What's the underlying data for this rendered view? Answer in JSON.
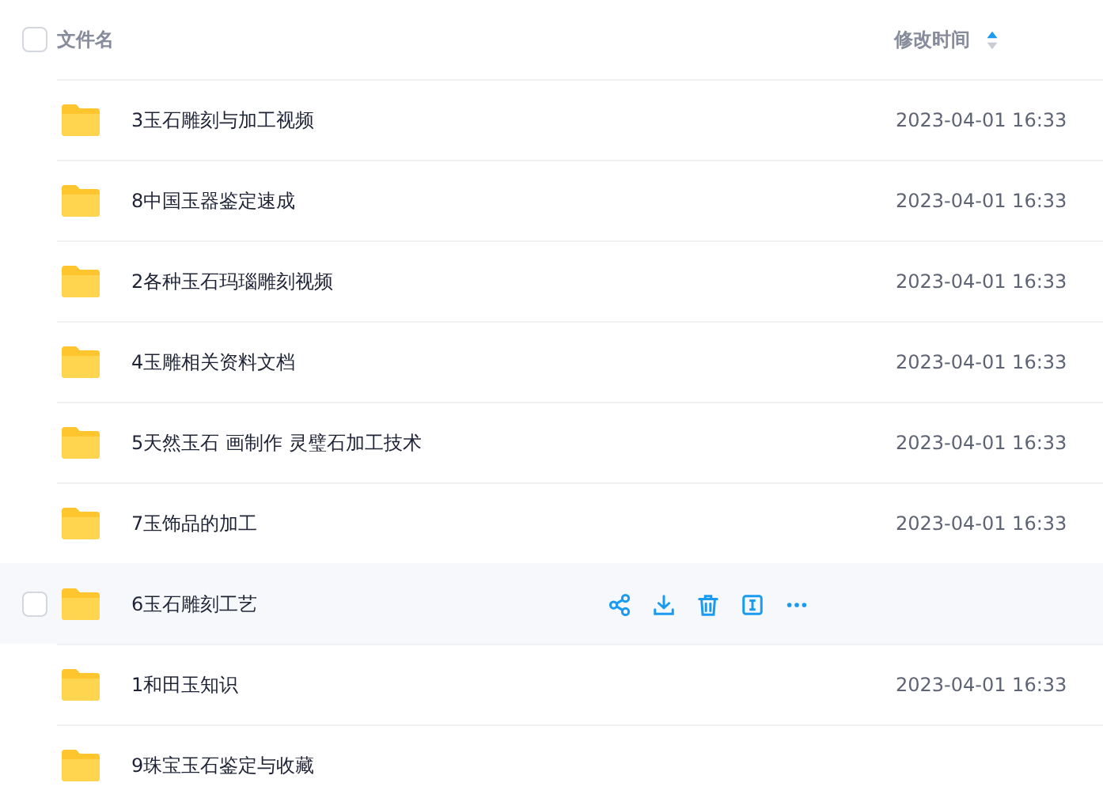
{
  "header": {
    "checked": false,
    "name_label": "文件名",
    "time_label": "修改时间",
    "sort_ascending": true
  },
  "rows": [
    {
      "name": "3玉石雕刻与加工视频",
      "time": "2023-04-01 16:33",
      "hovered": false
    },
    {
      "name": "8中国玉器鉴定速成",
      "time": "2023-04-01 16:33",
      "hovered": false
    },
    {
      "name": "2各种玉石玛瑙雕刻视频",
      "time": "2023-04-01 16:33",
      "hovered": false
    },
    {
      "name": "4玉雕相关资料文档",
      "time": "2023-04-01 16:33",
      "hovered": false
    },
    {
      "name": "5天然玉石 画制作 灵璧石加工技术",
      "time": "2023-04-01 16:33",
      "hovered": false
    },
    {
      "name": "7玉饰品的加工",
      "time": "2023-04-01 16:33",
      "hovered": false
    },
    {
      "name": "6玉石雕刻工艺",
      "hovered": true
    },
    {
      "name": "1和田玉知识",
      "time": "2023-04-01 16:33",
      "hovered": false
    },
    {
      "name": "9珠宝玉石鉴定与收藏",
      "hovered": false
    }
  ]
}
